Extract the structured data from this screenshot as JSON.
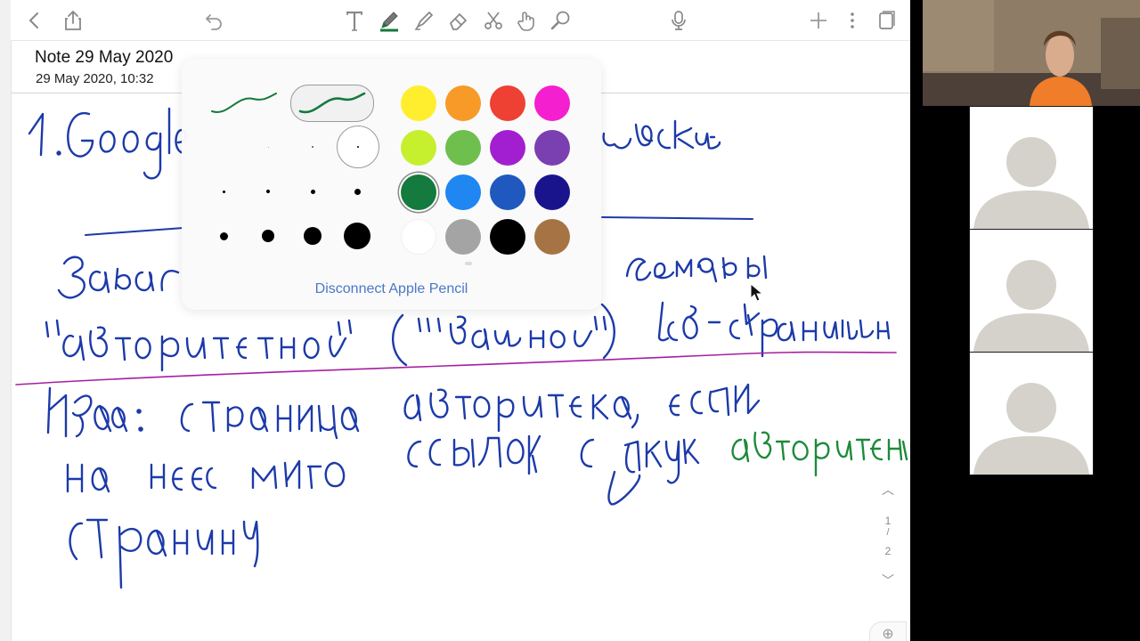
{
  "toolbar": {
    "left_icons": [
      "back-chevron-icon",
      "share-icon",
      "undo-icon"
    ],
    "tools": [
      "text-tool-icon",
      "pen-tool-icon",
      "highlighter-tool-icon",
      "eraser-tool-icon",
      "lasso-scissors-icon",
      "hand-pointer-icon",
      "zoom-magnifier-icon"
    ],
    "right_icons": [
      "microphone-icon",
      "add-icon",
      "more-vertical-icon",
      "pages-panel-icon"
    ],
    "active_tool": "pen-tool-icon"
  },
  "note": {
    "title": "Note 29 May 2020",
    "date": "29 May 2020, 10:32"
  },
  "pen_popover": {
    "styles": [
      "fine-tip",
      "brush-tip"
    ],
    "selected_style": 1,
    "selected_size": "row-1-col-4",
    "colors": [
      "#ffee2e",
      "#f79a28",
      "#ee4033",
      "#f41fcf",
      "#c6ef2d",
      "#6fbf4e",
      "#a21fd1",
      "#7a3fb0",
      "#147a3d",
      "#1f86f2",
      "#1f58bf",
      "#1a148c",
      "#ffffff",
      "#a4a4a4",
      "#000000",
      "#a67444"
    ],
    "selected_color": "#147a3d",
    "disconnect_label": "Disconnect Apple Pencil"
  },
  "pager": {
    "current": "1",
    "separator": "/",
    "total": "2"
  },
  "video_panel": {
    "participants": 3
  }
}
